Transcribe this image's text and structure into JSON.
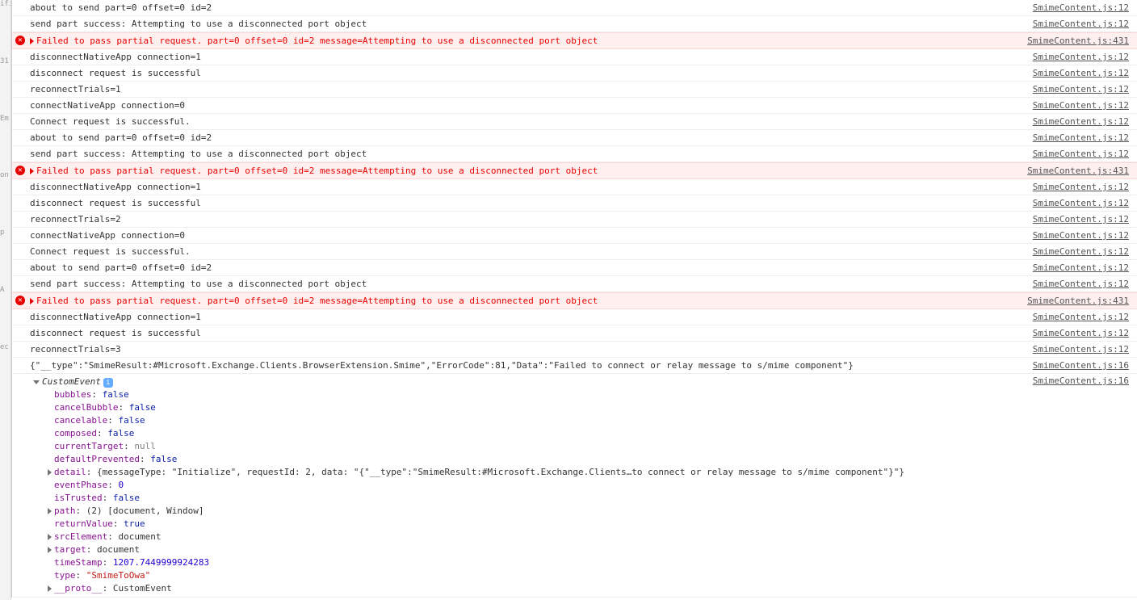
{
  "leftbar": [
    "ifie",
    "31",
    "Em",
    "on",
    "p",
    "A",
    "ec"
  ],
  "src_file": "SmimeContent.js",
  "logs": [
    {
      "type": "log",
      "msg": "about to send part=0 offset=0 id=2",
      "line": 12
    },
    {
      "type": "log",
      "msg": "send part success: Attempting to use a disconnected port object",
      "line": 12
    },
    {
      "type": "error",
      "msg": "Failed to pass partial request. part=0 offset=0 id=2 message=Attempting to use a disconnected port object",
      "line": 431,
      "expandable": true
    },
    {
      "type": "log",
      "msg": "disconnectNativeApp connection=1",
      "line": 12
    },
    {
      "type": "log",
      "msg": "disconnect request is successful",
      "line": 12
    },
    {
      "type": "log",
      "msg": "reconnectTrials=1",
      "line": 12
    },
    {
      "type": "log",
      "msg": "connectNativeApp connection=0",
      "line": 12
    },
    {
      "type": "log",
      "msg": "Connect request is successful.",
      "line": 12
    },
    {
      "type": "log",
      "msg": "about to send part=0 offset=0 id=2",
      "line": 12
    },
    {
      "type": "log",
      "msg": "send part success: Attempting to use a disconnected port object",
      "line": 12
    },
    {
      "type": "error",
      "msg": "Failed to pass partial request. part=0 offset=0 id=2 message=Attempting to use a disconnected port object",
      "line": 431,
      "expandable": true
    },
    {
      "type": "log",
      "msg": "disconnectNativeApp connection=1",
      "line": 12
    },
    {
      "type": "log",
      "msg": "disconnect request is successful",
      "line": 12
    },
    {
      "type": "log",
      "msg": "reconnectTrials=2",
      "line": 12
    },
    {
      "type": "log",
      "msg": "connectNativeApp connection=0",
      "line": 12
    },
    {
      "type": "log",
      "msg": "Connect request is successful.",
      "line": 12
    },
    {
      "type": "log",
      "msg": "about to send part=0 offset=0 id=2",
      "line": 12
    },
    {
      "type": "log",
      "msg": "send part success: Attempting to use a disconnected port object",
      "line": 12
    },
    {
      "type": "error",
      "msg": "Failed to pass partial request. part=0 offset=0 id=2 message=Attempting to use a disconnected port object",
      "line": 431,
      "expandable": true
    },
    {
      "type": "log",
      "msg": "disconnectNativeApp connection=1",
      "line": 12
    },
    {
      "type": "log",
      "msg": "disconnect request is successful",
      "line": 12
    },
    {
      "type": "log",
      "msg": "reconnectTrials=3",
      "line": 12
    },
    {
      "type": "log",
      "msg": "{\"__type\":\"SmimeResult:#Microsoft.Exchange.Clients.BrowserExtension.Smime\",\"ErrorCode\":81,\"Data\":\"Failed to connect or relay message to s/mime component\"}",
      "line": 16
    }
  ],
  "expanded": {
    "src_line": 16,
    "header": "CustomEvent",
    "props": [
      {
        "key": "bubbles",
        "val": "false",
        "cls": "bool",
        "exp": false
      },
      {
        "key": "cancelBubble",
        "val": "false",
        "cls": "bool",
        "exp": false
      },
      {
        "key": "cancelable",
        "val": "false",
        "cls": "bool",
        "exp": false
      },
      {
        "key": "composed",
        "val": "false",
        "cls": "bool",
        "exp": false
      },
      {
        "key": "currentTarget",
        "val": "null",
        "cls": "null",
        "exp": false
      },
      {
        "key": "defaultPrevented",
        "val": "false",
        "cls": "bool",
        "exp": false
      },
      {
        "key": "detail",
        "val": "{messageType: \"Initialize\", requestId: 2, data: \"{\"__type\":\"SmimeResult:#Microsoft.Exchange.Clients…to connect or relay message to s/mime component\"}\"}",
        "cls": "obj",
        "exp": true
      },
      {
        "key": "eventPhase",
        "val": "0",
        "cls": "num",
        "exp": false
      },
      {
        "key": "isTrusted",
        "val": "false",
        "cls": "bool",
        "exp": false
      },
      {
        "key": "path",
        "val": "(2) [document, Window]",
        "cls": "obj",
        "exp": true
      },
      {
        "key": "returnValue",
        "val": "true",
        "cls": "bool",
        "exp": false
      },
      {
        "key": "srcElement",
        "val": "document",
        "cls": "obj",
        "exp": true
      },
      {
        "key": "target",
        "val": "document",
        "cls": "obj",
        "exp": true
      },
      {
        "key": "timeStamp",
        "val": "1207.7449999924283",
        "cls": "num",
        "exp": false
      },
      {
        "key": "type",
        "val": "\"SmimeToOwa\"",
        "cls": "str",
        "exp": false
      },
      {
        "key": "__proto__",
        "val": "CustomEvent",
        "cls": "obj",
        "exp": true
      }
    ]
  }
}
